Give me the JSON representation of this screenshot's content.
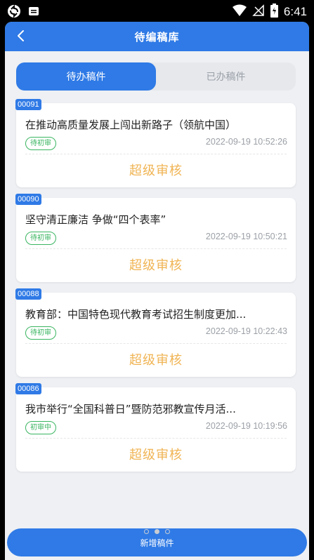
{
  "status_bar": {
    "time": "6:41",
    "icons": [
      "sync-icon",
      "message-icon",
      "wifi-icon",
      "no-signal-icon",
      "battery-icon"
    ]
  },
  "navbar": {
    "title": "待编稿库",
    "back_icon": "chevron-left-icon"
  },
  "tabs": [
    {
      "label": "待办稿件",
      "active": true
    },
    {
      "label": "已办稿件",
      "active": false
    }
  ],
  "cards": [
    {
      "id": "00091",
      "title": "在推动高质量发展上闯出新路子（领航中国）",
      "status": "待初审",
      "time": "2022-09-19 10:52:26",
      "action": "超级审核"
    },
    {
      "id": "00090",
      "title": "坚守清正廉洁 争做“四个表率”",
      "status": "待初审",
      "time": "2022-09-19 10:50:21",
      "action": "超级审核"
    },
    {
      "id": "00088",
      "title": "教育部：中国特色现代教育考试招生制度更加...",
      "status": "待初审",
      "time": "2022-09-19 10:22:43",
      "action": "超级审核"
    },
    {
      "id": "00086",
      "title": "我市举行“全国科普日”暨防范邪教宣传月活...",
      "status": "初审中",
      "time": "2022-09-19 10:19:56",
      "action": "超级审核"
    }
  ],
  "pager": {
    "count": 3,
    "active_index": 1
  },
  "bottom_button": {
    "label": "新增稿件"
  },
  "colors": {
    "primary": "#2f7ae6",
    "status_green": "#39b560",
    "action_gold": "#f0b454",
    "background": "#eef0f4"
  }
}
